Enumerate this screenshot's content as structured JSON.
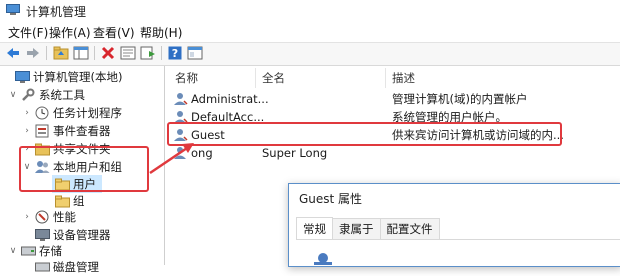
{
  "window": {
    "title": "计算机管理"
  },
  "menu": [
    {
      "label": "文件(F)"
    },
    {
      "label": "操作(A)"
    },
    {
      "label": "查看(V)"
    },
    {
      "label": "帮助(H)"
    }
  ],
  "toolbar": {
    "icons": [
      "back-arrow-icon",
      "forward-arrow-icon",
      "up-folder-icon",
      "show-hide-tree-icon",
      "delete-icon",
      "properties-icon",
      "export-list-icon",
      "help-icon",
      "mmc-icon"
    ]
  },
  "tree": {
    "root": "计算机管理(本地)",
    "system_tools": "系统工具",
    "task_scheduler": "任务计划程序",
    "event_viewer": "事件查看器",
    "shared_folders": "共享文件夹",
    "local_users_groups": "本地用户和组",
    "users": "用户",
    "groups": "组",
    "performance": "性能",
    "device_manager": "设备管理器",
    "storage": "存储",
    "disk_management": "磁盘管理"
  },
  "list": {
    "columns": [
      "名称",
      "全名",
      "描述"
    ],
    "rows": [
      {
        "name": "Administrat...",
        "fullname": "",
        "desc": "管理计算机(域)的内置帐户"
      },
      {
        "name": "DefaultAcc...",
        "fullname": "",
        "desc": "系统管理的用户帐户。"
      },
      {
        "name": "Guest",
        "fullname": "",
        "desc": "供来宾访问计算机或访问域的内..."
      },
      {
        "name": "ong",
        "fullname": "Super Long",
        "desc": ""
      }
    ]
  },
  "dialog": {
    "title": "Guest 属性",
    "tabs": [
      {
        "label": "常规",
        "active": true
      },
      {
        "label": "隶属于",
        "active": false
      },
      {
        "label": "配置文件",
        "active": false
      }
    ]
  },
  "colors": {
    "annotation_red": "#e0393e",
    "selection_blue": "#cce8ff"
  }
}
